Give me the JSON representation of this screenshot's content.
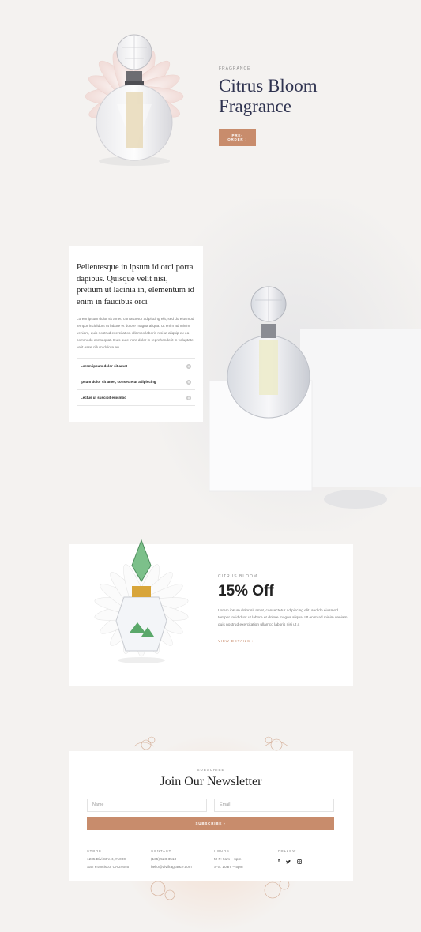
{
  "hero": {
    "eyebrow": "FRAGRANCE",
    "title_line1": "Citrus Bloom",
    "title_line2": "Fragrance",
    "button": "PRE-ORDER ›"
  },
  "about": {
    "title": "Pellentesque in ipsum id orci porta dapibus. Quisque velit nisi, pretium ut lacinia in, elementum id enim in faucibus orci",
    "body": "Lorem ipsum dolor sit amet, consectetur adipiscing elit, sed do eiusmod tempor incididunt ut labore et dolore magna aliqua. Ut enim ad minim veniam, quis nostrud exercitation ullamco laboris nisi ut aliquip ex ea commodo consequat. Duis aute irure dolor in reprehenderit in voluptate velit esse cillum dolore eu.",
    "accordion": [
      {
        "label": "Lorem ipsum dolor sit amet"
      },
      {
        "label": "Ipsum dolor sit amet, consectetur adipiscing"
      },
      {
        "label": "Lectus ut suscipit euismod"
      }
    ]
  },
  "promo": {
    "eyebrow": "CITRUS BLOOM",
    "title": "15% Off",
    "body": "Lorem ipsum dolor sit amet, consectetur adipiscing elit, sed do eiusmod tempor incididunt ut labore et dolore magna aliqua. Ut enim ad minim veniam, quis nostrud exercitation ullamco laboris nisi ut a",
    "link": "VIEW DETAILS ›"
  },
  "newsletter": {
    "eyebrow": "SUBSCRIBE",
    "title": "Join Our Newsletter",
    "name_placeholder": "Name",
    "email_placeholder": "Email",
    "button": "SUBSCRIBE ›"
  },
  "footer": {
    "store": {
      "heading": "STORE",
      "line1": "1235 Divi Street, #1000",
      "line2": "San Francisco, CA 24646"
    },
    "contact": {
      "heading": "CONTACT",
      "line1": "(135) 523-3513",
      "line2": "hello@divifragrance.com"
    },
    "hours": {
      "heading": "HOURS",
      "line1": "M-F: 9am – 6pm",
      "line2": "S-S: 10am – 5pm"
    },
    "follow": {
      "heading": "FOLLOW",
      "icons": [
        "facebook-icon",
        "twitter-icon",
        "instagram-icon"
      ]
    }
  },
  "colors": {
    "accent": "#c88c6c",
    "title": "#2f3350",
    "background": "#f4f2f0"
  }
}
